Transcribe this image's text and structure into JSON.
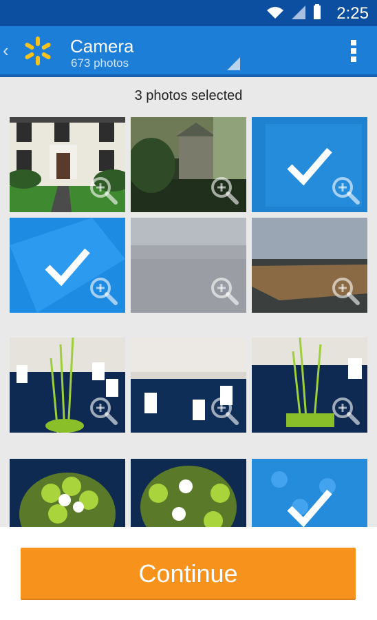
{
  "status_bar": {
    "time": "2:25"
  },
  "header": {
    "title": "Camera",
    "subtitle": "673 photos"
  },
  "selection": {
    "label": "3 photos selected"
  },
  "photos": [
    {
      "name": "house",
      "selected": false
    },
    {
      "name": "garden-shed",
      "selected": false
    },
    {
      "name": "water-steps",
      "selected": true
    },
    {
      "name": "pool",
      "selected": true
    },
    {
      "name": "clouds",
      "selected": false
    },
    {
      "name": "aerial-coast",
      "selected": false
    },
    {
      "name": "banquet-1",
      "selected": false
    },
    {
      "name": "banquet-2",
      "selected": false
    },
    {
      "name": "banquet-3",
      "selected": false
    },
    {
      "name": "apples-centerpiece-1",
      "selected": false
    },
    {
      "name": "apples-centerpiece-2",
      "selected": false
    },
    {
      "name": "flowers",
      "selected": true
    }
  ],
  "footer": {
    "continue_label": "Continue"
  },
  "colors": {
    "status_bar": "#0c4fa0",
    "app_bar": "#1d7ed7",
    "continue_button": "#f7931d"
  }
}
